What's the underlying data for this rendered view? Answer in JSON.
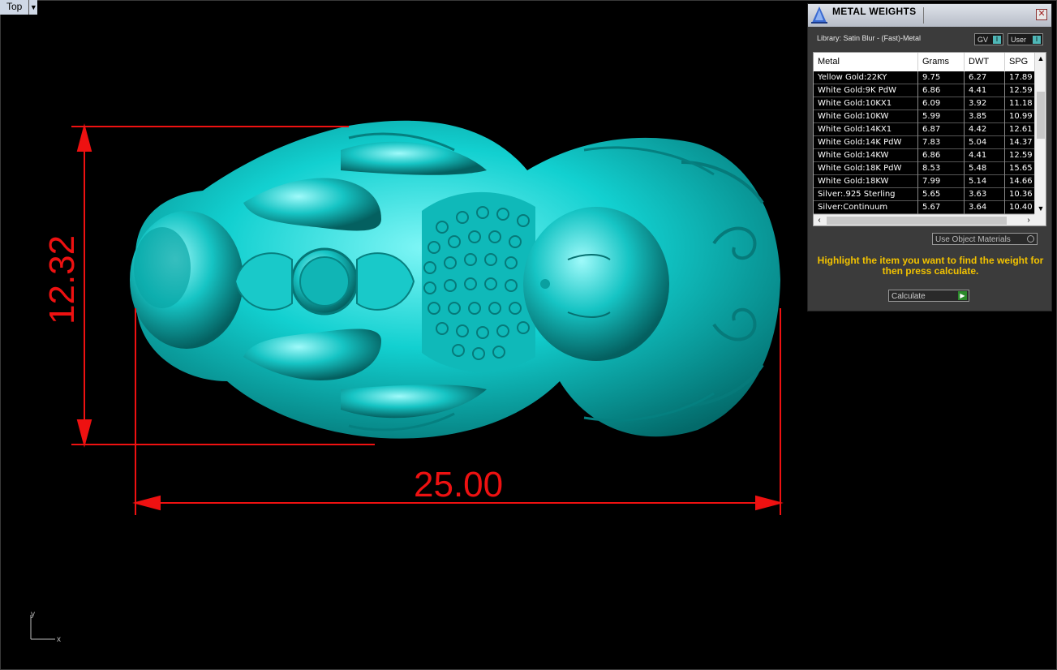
{
  "viewport": {
    "view_name": "Top",
    "dimension_width": "25.00",
    "dimension_height": "12.32",
    "axis_x_label": "x",
    "axis_y_label": "y",
    "model_color": "#00c8c8",
    "dimension_color": "#ee1111"
  },
  "panel": {
    "title": "METAL WEIGHTS",
    "library_label": "Library: Satin Blur - (Fast)-Metal",
    "gv_label": "GV",
    "user_label": "User",
    "columns": [
      "Metal",
      "Grams",
      "DWT",
      "SPG"
    ],
    "rows": [
      [
        "Yellow Gold:22KY",
        "9.75",
        "6.27",
        "17.89"
      ],
      [
        "White Gold:9K PdW",
        "6.86",
        "4.41",
        "12.59"
      ],
      [
        "White Gold:10KX1",
        "6.09",
        "3.92",
        "11.18"
      ],
      [
        "White Gold:10KW",
        "5.99",
        "3.85",
        "10.99"
      ],
      [
        "White Gold:14KX1",
        "6.87",
        "4.42",
        "12.61"
      ],
      [
        "White Gold:14K PdW",
        "7.83",
        "5.04",
        "14.37"
      ],
      [
        "White Gold:14KW",
        "6.86",
        "4.41",
        "12.59"
      ],
      [
        "White Gold:18K PdW",
        "8.53",
        "5.48",
        "15.65"
      ],
      [
        "White Gold:18KW",
        "7.99",
        "5.14",
        "14.66"
      ],
      [
        "Silver:.925 Sterling",
        "5.65",
        "3.63",
        "10.36"
      ],
      [
        "Silver:Continuum",
        "5.67",
        "3.64",
        "10.40"
      ]
    ],
    "use_object_materials": "Use Object Materials",
    "hint": "Highlight the item you want to find the weight for then press calculate.",
    "calculate_label": "Calculate",
    "hint_color": "#f2c200"
  }
}
